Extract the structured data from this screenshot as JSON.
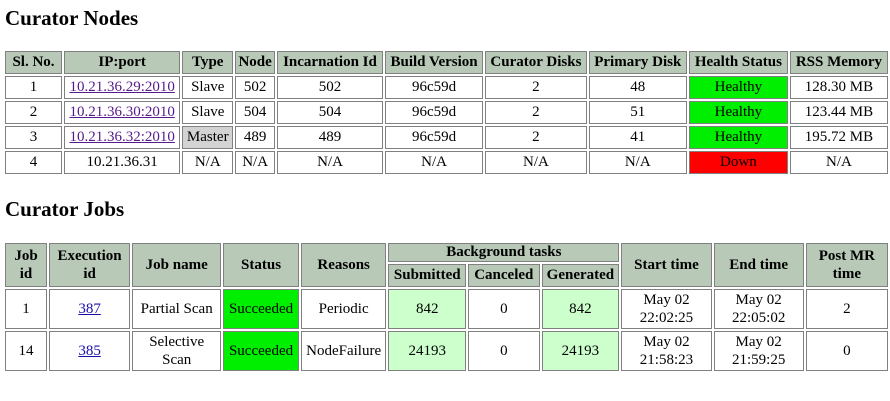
{
  "nodes_section": {
    "title": "Curator Nodes",
    "columns": [
      "Sl. No.",
      "IP:port",
      "Type",
      "Node",
      "Incarnation Id",
      "Build Version",
      "Curator Disks",
      "Primary Disk",
      "Health Status",
      "RSS Memory"
    ],
    "rows": [
      {
        "sl": "1",
        "ip": "10.21.36.29:2010",
        "type": "Slave",
        "node": "502",
        "incarnation": "502",
        "build": "96c59d",
        "disks": "2",
        "primary": "48",
        "health": "Healthy",
        "rss": "128.30 MB"
      },
      {
        "sl": "2",
        "ip": "10.21.36.30:2010",
        "type": "Slave",
        "node": "504",
        "incarnation": "504",
        "build": "96c59d",
        "disks": "2",
        "primary": "51",
        "health": "Healthy",
        "rss": "123.44 MB"
      },
      {
        "sl": "3",
        "ip": "10.21.36.32:2010",
        "type": "Master",
        "node": "489",
        "incarnation": "489",
        "build": "96c59d",
        "disks": "2",
        "primary": "41",
        "health": "Healthy",
        "rss": "195.72 MB"
      },
      {
        "sl": "4",
        "ip": "10.21.36.31",
        "type": "N/A",
        "node": "N/A",
        "incarnation": "N/A",
        "build": "N/A",
        "disks": "N/A",
        "primary": "N/A",
        "health": "Down",
        "rss": "N/A"
      }
    ]
  },
  "jobs_section": {
    "title": "Curator Jobs",
    "columns": {
      "job_id": "Job id",
      "execution_id": "Execution id",
      "job_name": "Job name",
      "status": "Status",
      "reasons": "Reasons",
      "background_tasks": "Background tasks",
      "submitted": "Submitted",
      "canceled": "Canceled",
      "generated": "Generated",
      "start_time": "Start time",
      "end_time": "End time",
      "post_mr_time": "Post MR time"
    },
    "rows": [
      {
        "job_id": "1",
        "execution_id": "387",
        "job_name": "Partial Scan",
        "status": "Succeeded",
        "reasons": "Periodic",
        "submitted": "842",
        "canceled": "0",
        "generated": "842",
        "start_date": "May 02",
        "start_clock": "22:02:25",
        "end_date": "May 02",
        "end_clock": "22:05:02",
        "post_mr": "2"
      },
      {
        "job_id": "14",
        "execution_id": "385",
        "job_name_line1": "Selective",
        "job_name_line2": "Scan",
        "status": "Succeeded",
        "reasons": "NodeFailure",
        "submitted": "24193",
        "canceled": "0",
        "generated": "24193",
        "start_date": "May 02",
        "start_clock": "21:58:23",
        "end_date": "May 02",
        "end_clock": "21:59:25",
        "post_mr": "0"
      }
    ]
  },
  "colors": {
    "header_bg": "#b8c9b8",
    "healthy": "#00ee00",
    "down": "#ff0000",
    "master": "#d3d3d3",
    "task_green": "#ccffcc",
    "link": "#1a0dab"
  }
}
